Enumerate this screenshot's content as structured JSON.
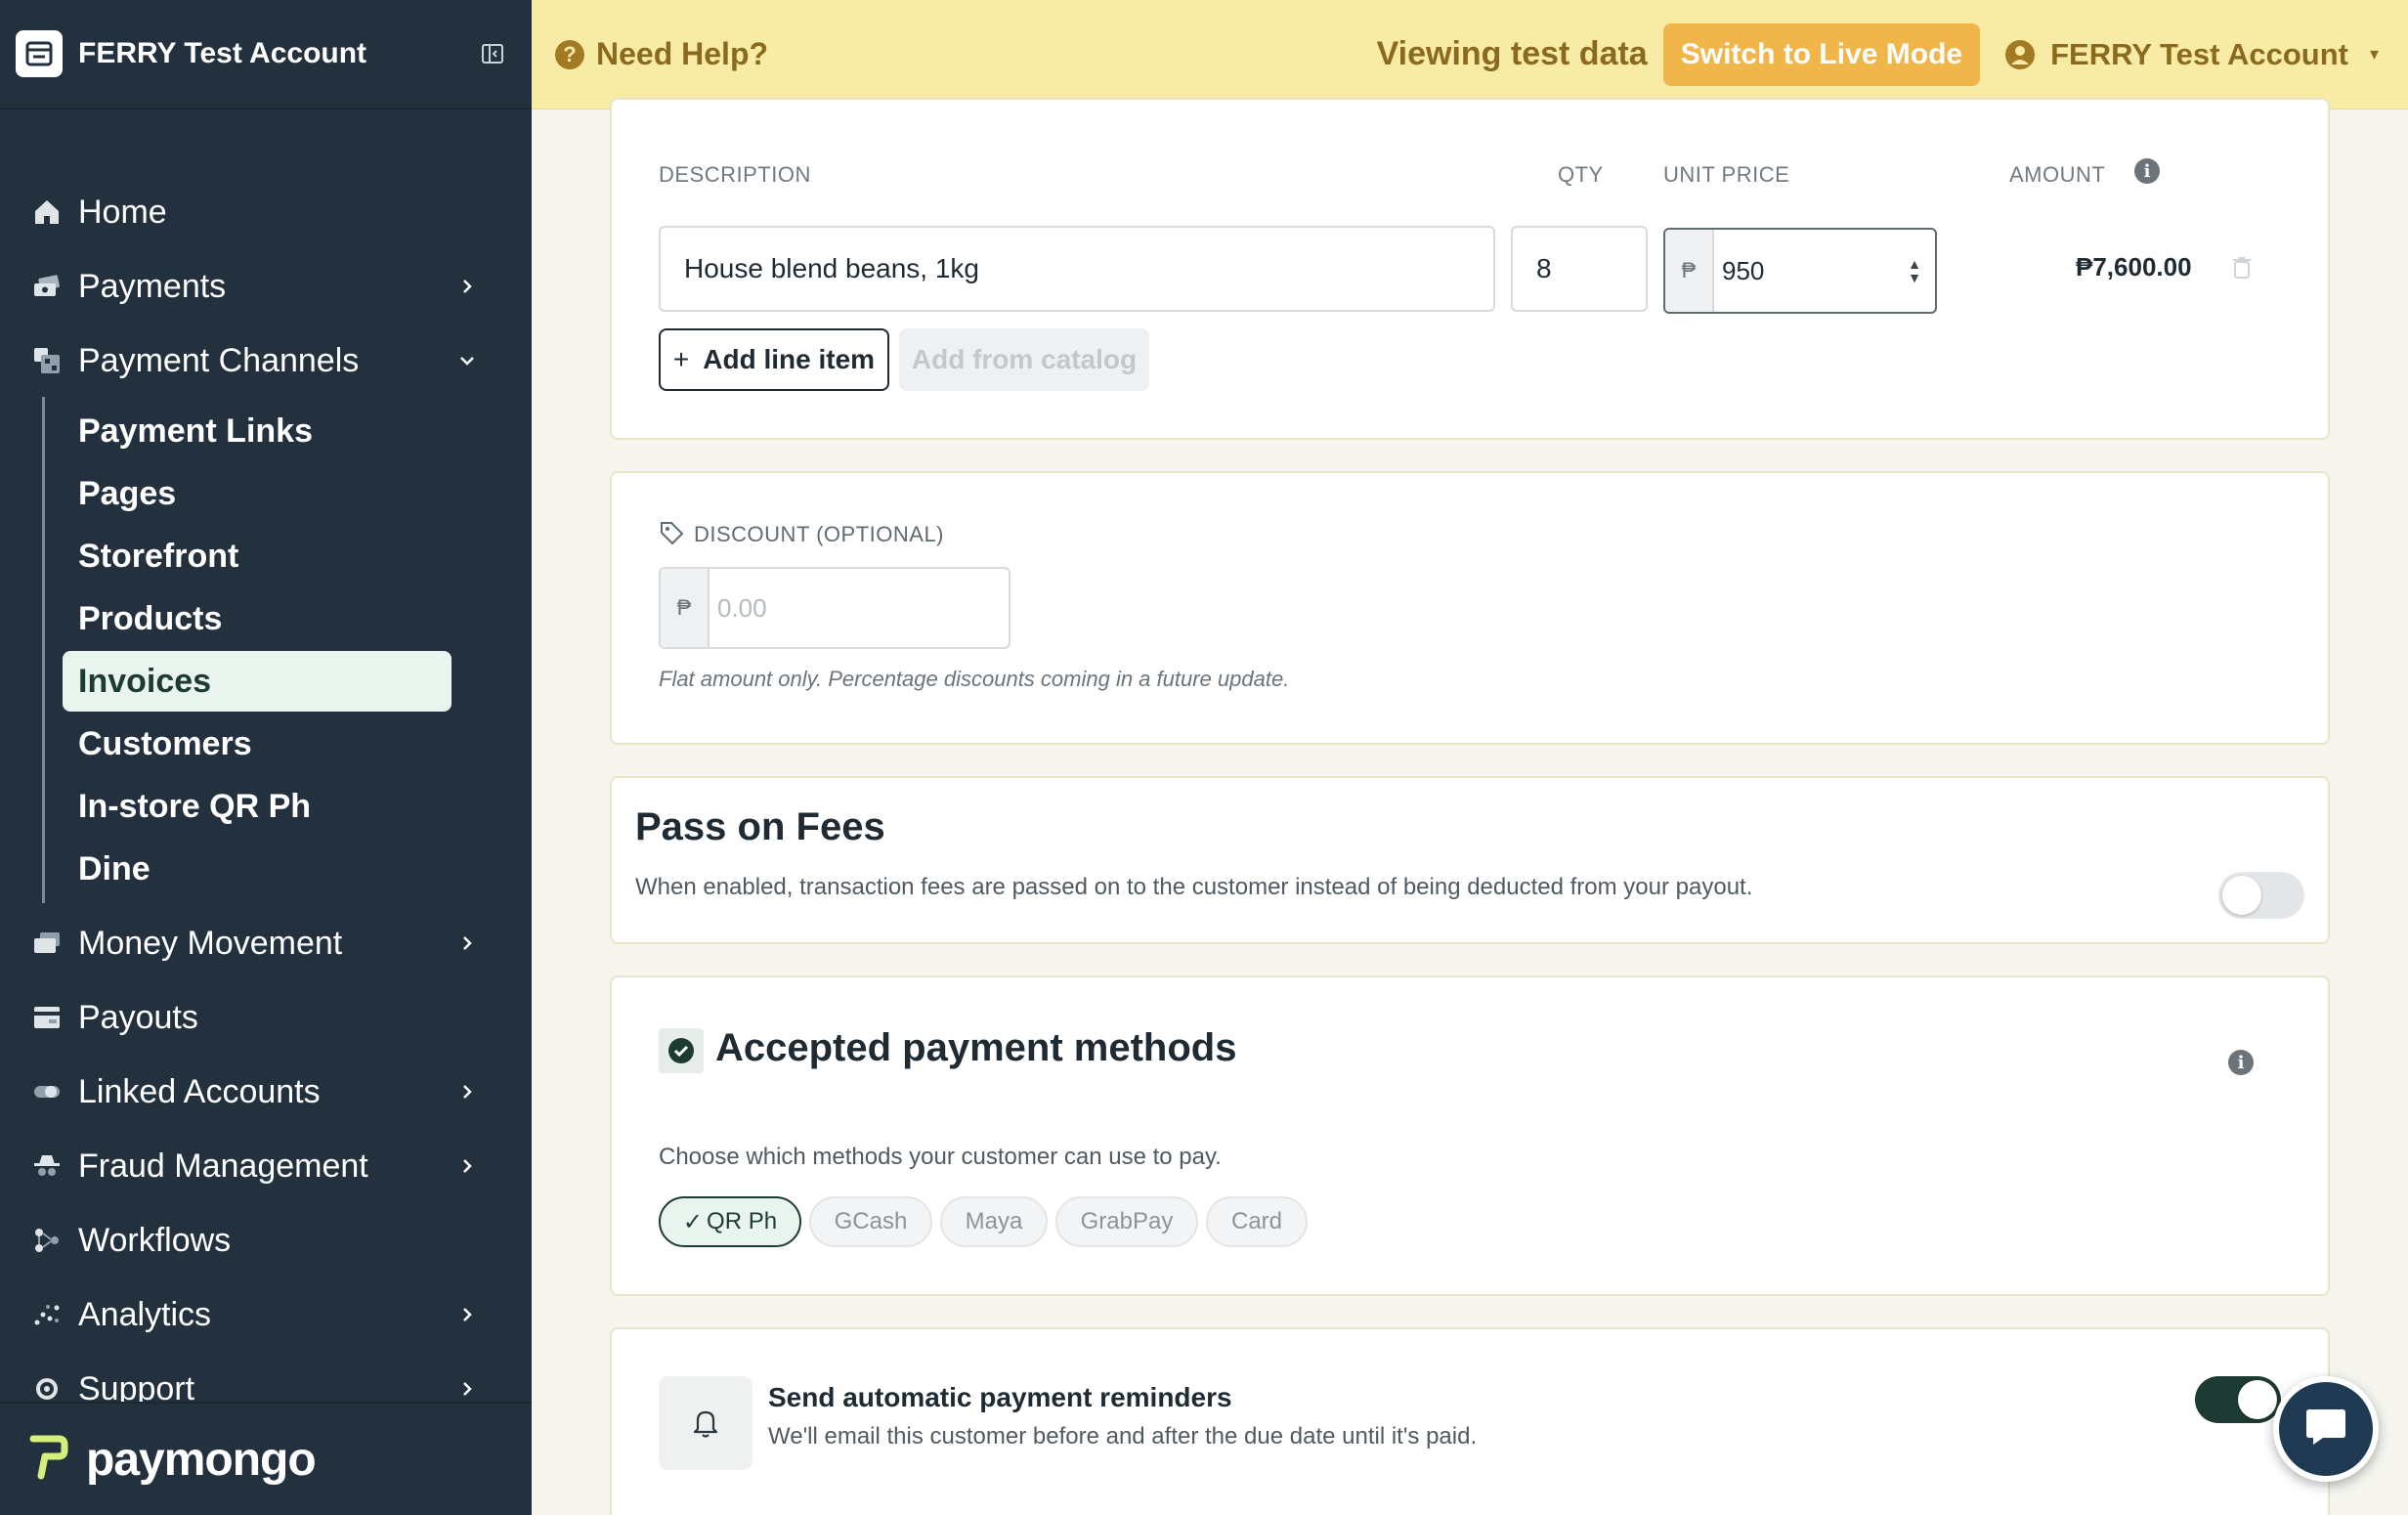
{
  "sidebar": {
    "account_name": "FERRY Test Account",
    "nav": [
      {
        "label": "Home",
        "icon": "home-icon"
      },
      {
        "label": "Payments",
        "icon": "payments-icon"
      },
      {
        "label": "Payment Channels",
        "icon": "channels-icon"
      },
      {
        "label": "Money Movement",
        "icon": "money-icon"
      },
      {
        "label": "Payouts",
        "icon": "payouts-icon"
      },
      {
        "label": "Linked Accounts",
        "icon": "link-icon"
      },
      {
        "label": "Fraud Management",
        "icon": "spy-icon"
      },
      {
        "label": "Workflows",
        "icon": "workflow-icon"
      },
      {
        "label": "Analytics",
        "icon": "analytics-icon"
      },
      {
        "label": "Support",
        "icon": "gear-icon"
      }
    ],
    "subnav": [
      "Payment Links",
      "Pages",
      "Storefront",
      "Products",
      "Invoices",
      "Customers",
      "In-store QR Ph",
      "Dine"
    ],
    "active_subnav": "Invoices",
    "brand": "paymongo"
  },
  "topbar": {
    "help": "Need Help?",
    "viewing": "Viewing test data",
    "switch_live": "Switch to Live Mode",
    "account": "FERRY Test Account"
  },
  "line_items": {
    "headers": {
      "description": "DESCRIPTION",
      "qty": "QTY",
      "unit_price": "UNIT PRICE",
      "amount": "AMOUNT"
    },
    "rows": [
      {
        "description": "House blend beans, 1kg",
        "qty": "8",
        "currency": "₱",
        "unit_price": "950",
        "amount": "₱7,600.00"
      }
    ],
    "add_line_item": "Add line item",
    "add_from_catalog": "Add from catalog"
  },
  "discount": {
    "label": "DISCOUNT (OPTIONAL)",
    "currency": "₱",
    "placeholder": "0.00",
    "note": "Flat amount only. Percentage discounts coming in a future update."
  },
  "pass_on_fees": {
    "title": "Pass on Fees",
    "description": "When enabled, transaction fees are passed on to the customer instead of being deducted from your payout.",
    "enabled": false
  },
  "payment_methods": {
    "title": "Accepted payment methods",
    "description": "Choose which methods your customer can use to pay.",
    "methods": [
      {
        "label": "QR Ph",
        "selected": true
      },
      {
        "label": "GCash",
        "selected": false
      },
      {
        "label": "Maya",
        "selected": false
      },
      {
        "label": "GrabPay",
        "selected": false
      },
      {
        "label": "Card",
        "selected": false
      }
    ]
  },
  "reminders": {
    "title": "Send automatic payment reminders",
    "description": "We'll email this customer before and after the due date until it's paid.",
    "enabled": true
  },
  "colors": {
    "sidebar_bg": "#23313f",
    "topbar_bg": "#f8eba6",
    "live_button": "#f0b64a",
    "accent_dark_green": "#1e3b33",
    "brand_lime": "#d4f07a"
  }
}
